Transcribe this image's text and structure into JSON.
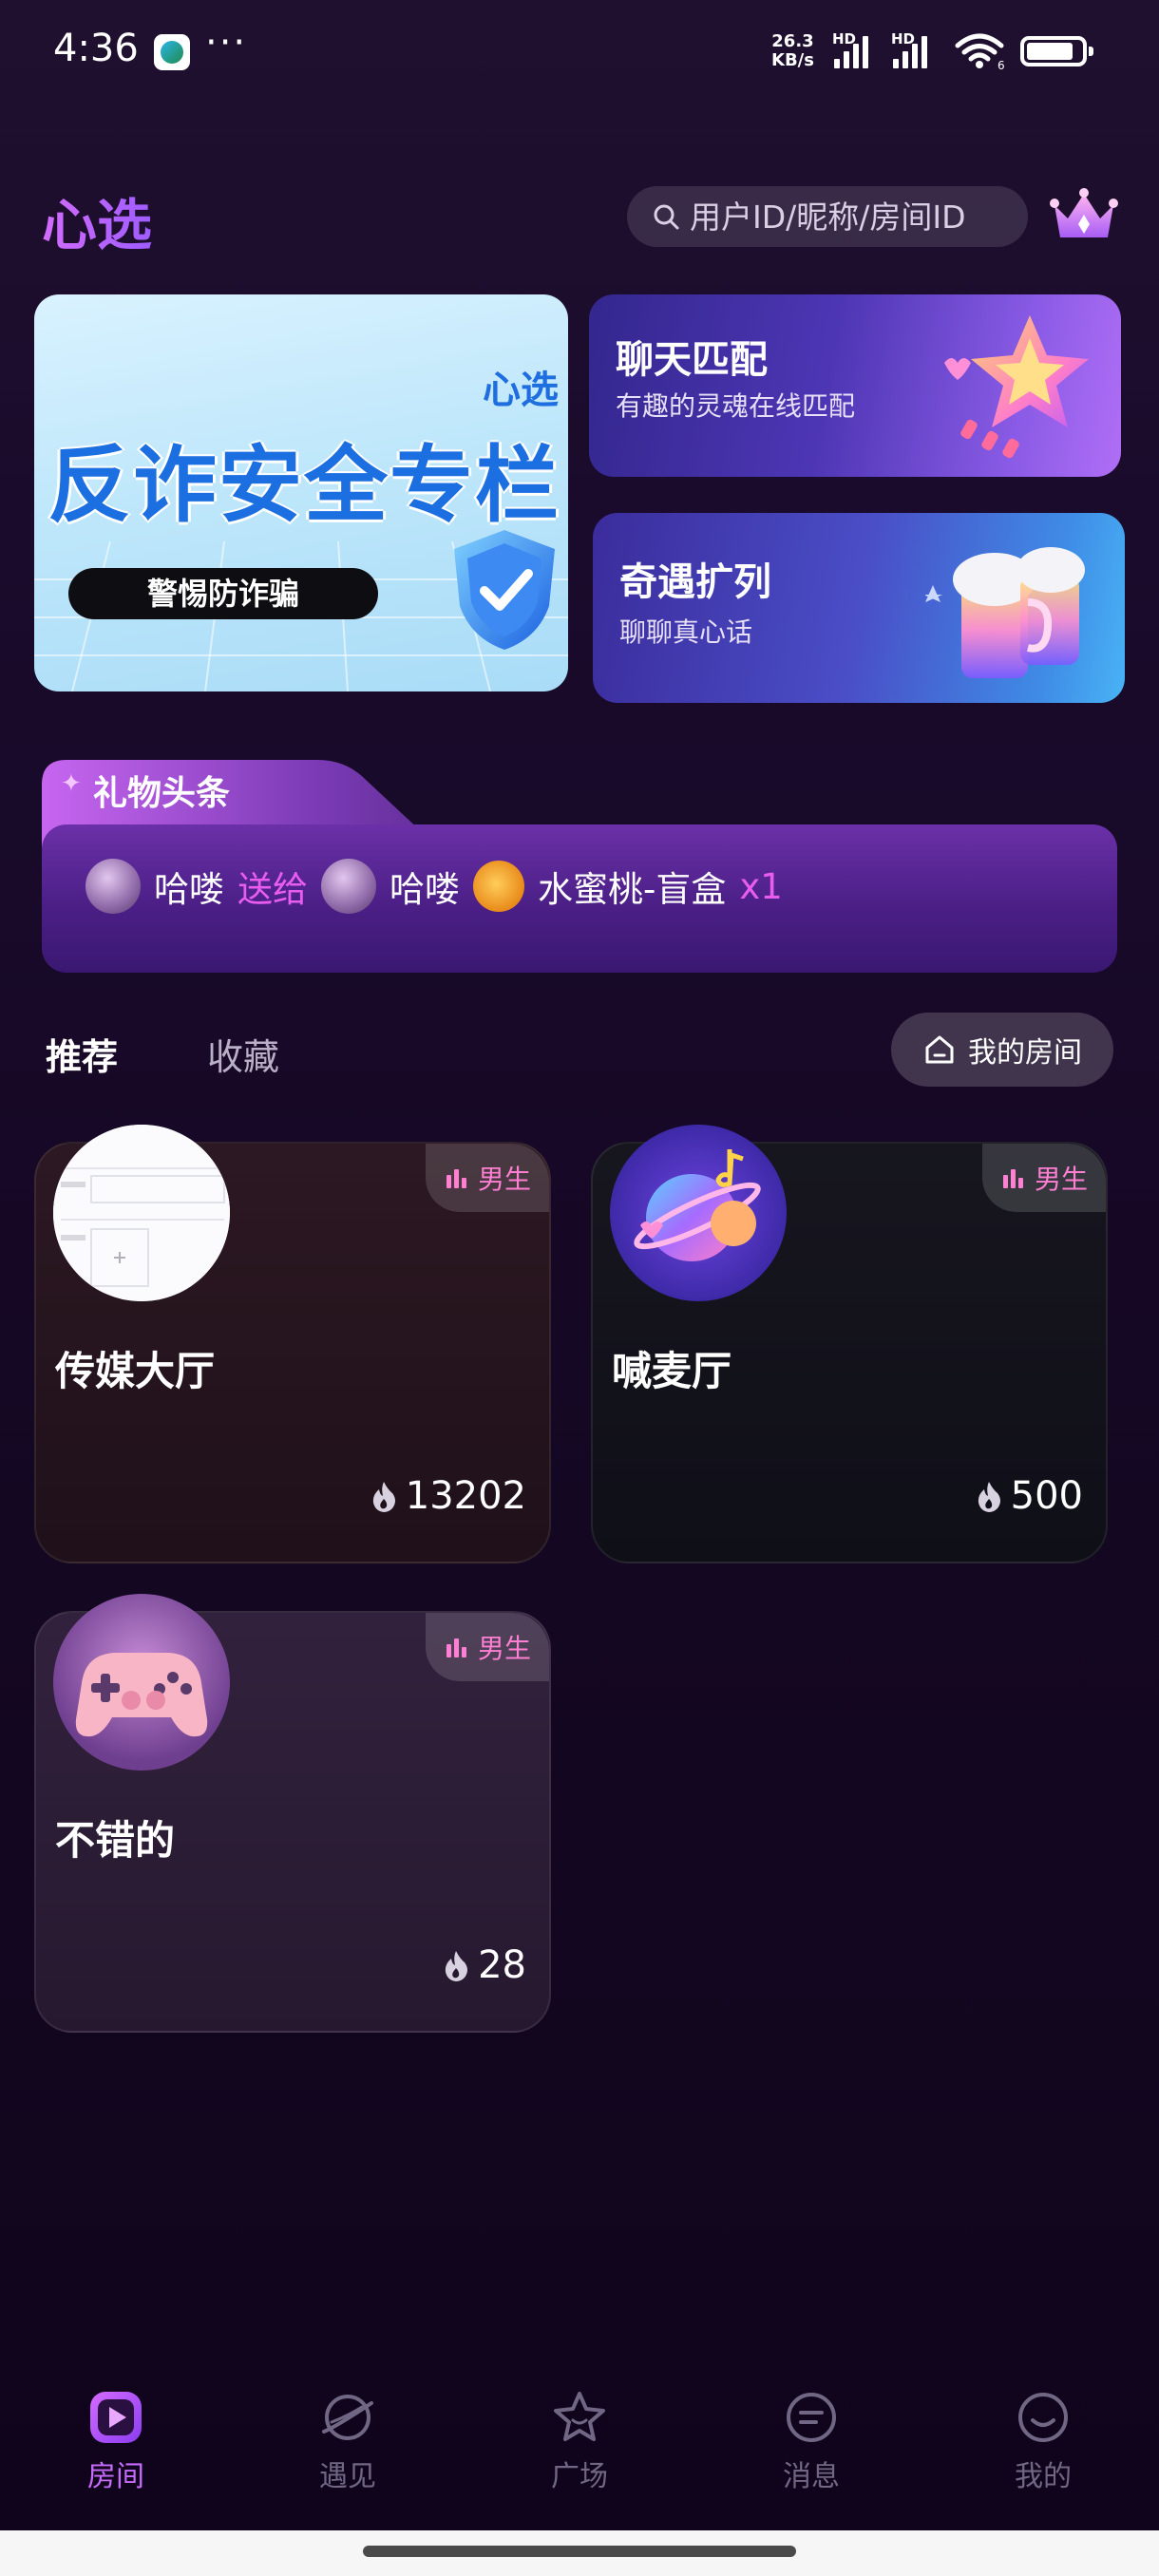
{
  "status_bar": {
    "time": "4:36",
    "more": "···",
    "speed_value": "26.3",
    "speed_unit": "KB/s",
    "hd1": "HD",
    "hd2": "HD",
    "wifi_badge": "6"
  },
  "header": {
    "title": "心选",
    "search_placeholder": "用户ID/昵称/房间ID"
  },
  "banners": {
    "main": {
      "brand": "心选",
      "heading": "反诈安全专栏",
      "pill": "警惕防诈骗"
    },
    "chat_match": {
      "title": "聊天匹配",
      "subtitle": "有趣的灵魂在线匹配"
    },
    "encounter": {
      "title": "奇遇扩列",
      "subtitle": "聊聊真心话"
    }
  },
  "gift_headline": {
    "title": "礼物头条",
    "sender": "哈喽",
    "verb": "送给",
    "receiver": "哈喽",
    "gift_name": "水蜜桃-盲盒",
    "count": "x1"
  },
  "tabs": {
    "recommend": "推荐",
    "favorites": "收藏",
    "my_room": "我的房间"
  },
  "rooms": [
    {
      "name": "传媒大厅",
      "heat": "13202",
      "tag": "男生"
    },
    {
      "name": "喊麦厅",
      "heat": "500",
      "tag": "男生"
    },
    {
      "name": "不错的",
      "heat": "28",
      "tag": "男生"
    }
  ],
  "nav": [
    {
      "label": "房间",
      "icon": "play-icon",
      "active": true
    },
    {
      "label": "遇见",
      "icon": "planet-icon",
      "active": false
    },
    {
      "label": "广场",
      "icon": "star-icon",
      "active": false
    },
    {
      "label": "消息",
      "icon": "message-icon",
      "active": false
    },
    {
      "label": "我的",
      "icon": "smile-icon",
      "active": false
    }
  ],
  "colors": {
    "accent": "#c86bff",
    "tag_pink": "#ff7fd3",
    "gift_highlight": "#e95cf0",
    "background": "#170828"
  }
}
